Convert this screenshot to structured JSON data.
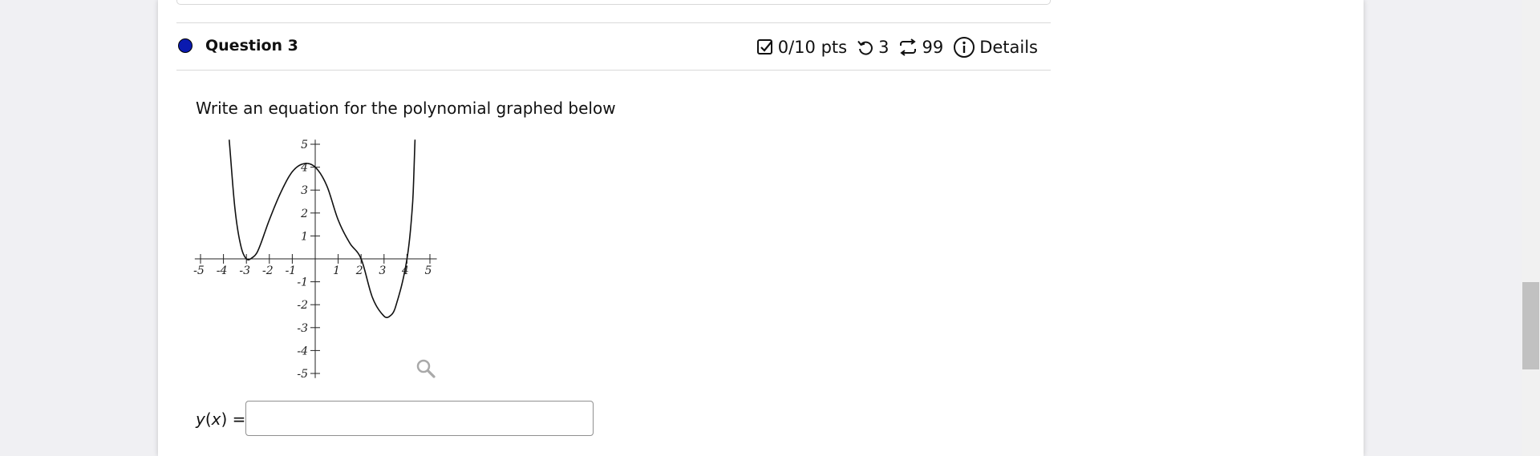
{
  "question": {
    "title": "Question 3",
    "status_dot_color": "#0a1ab0",
    "points": "0/10 pts",
    "retries": "3",
    "versions": "99",
    "details_label": "Details",
    "prompt": "Write an equation for the polynomial graphed below"
  },
  "graph": {
    "x_ticks": [
      "-5",
      "-4",
      "-3",
      "-2",
      "-1",
      "1",
      "2",
      "3",
      "4",
      "5"
    ],
    "y_ticks": [
      "5",
      "4",
      "3",
      "2",
      "1",
      "-1",
      "-2",
      "-3",
      "-4",
      "-5"
    ],
    "magnify_icon": "magnifier-icon"
  },
  "answer": {
    "label": "y(x) =",
    "value": "",
    "placeholder": ""
  }
}
